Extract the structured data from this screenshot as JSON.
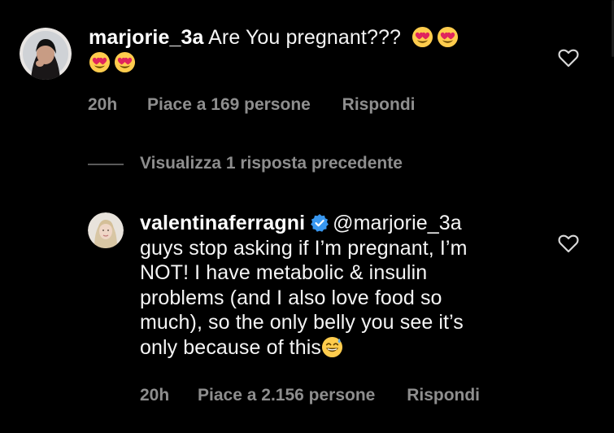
{
  "comment1": {
    "username": "marjorie_3a",
    "text": "Are You pregnant???",
    "emojis": [
      "heart-eyes",
      "heart-eyes",
      "heart-eyes",
      "heart-eyes"
    ],
    "time": "20h",
    "likes": "Piace a 169 persone",
    "reply_label": "Rispondi"
  },
  "replies_toggle": {
    "label": "Visualizza 1 risposta precedente"
  },
  "comment2": {
    "username": "valentinaferragni",
    "mention": "@marjorie_3a",
    "lines": [
      "guys stop asking if I’m pregnant, I’m",
      "NOT! I have metabolic & insulin",
      "problems (and I also love food so",
      "much), so the only belly you see it’s",
      "only because of this"
    ],
    "emoji": "sweat-smile",
    "time": "20h",
    "likes": "Piace a 2.156 persone",
    "reply_label": "Rispondi"
  },
  "colors": {
    "background": "#000000",
    "text": "#f5f5f5",
    "meta": "#8e8e8e",
    "verified": "#3897f0"
  }
}
